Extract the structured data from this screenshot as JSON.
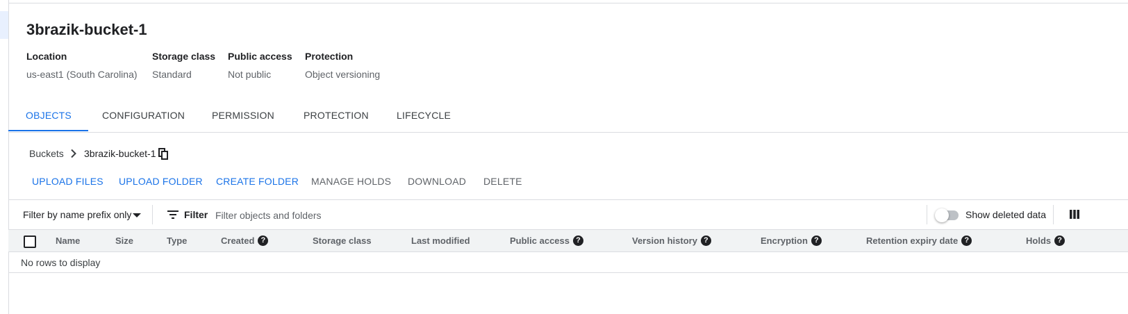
{
  "bucket": {
    "name": "3brazik-bucket-1",
    "details": [
      {
        "label": "Location",
        "value": "us-east1 (South Carolina)"
      },
      {
        "label": "Storage class",
        "value": "Standard"
      },
      {
        "label": "Public access",
        "value": "Not public"
      },
      {
        "label": "Protection",
        "value": "Object versioning"
      }
    ]
  },
  "tabs": [
    {
      "label": "OBJECTS",
      "active": true
    },
    {
      "label": "CONFIGURATION",
      "active": false
    },
    {
      "label": "PERMISSION",
      "active": false
    },
    {
      "label": "PROTECTION",
      "active": false
    },
    {
      "label": "LIFECYCLE",
      "active": false
    }
  ],
  "breadcrumb": {
    "root": "Buckets",
    "current": "3brazik-bucket-1"
  },
  "actions": [
    {
      "label": "UPLOAD FILES",
      "enabled": true
    },
    {
      "label": "UPLOAD FOLDER",
      "enabled": true
    },
    {
      "label": "CREATE FOLDER",
      "enabled": true
    },
    {
      "label": "MANAGE HOLDS",
      "enabled": false
    },
    {
      "label": "DOWNLOAD",
      "enabled": false
    },
    {
      "label": "DELETE",
      "enabled": false
    }
  ],
  "filter": {
    "prefix_select": "Filter by name prefix only",
    "label": "Filter",
    "placeholder": "Filter objects and folders",
    "show_deleted_label": "Show deleted data",
    "show_deleted": false
  },
  "table": {
    "columns": [
      {
        "label": "Name",
        "help": false
      },
      {
        "label": "Size",
        "help": false
      },
      {
        "label": "Type",
        "help": false
      },
      {
        "label": "Created",
        "help": true
      },
      {
        "label": "Storage class",
        "help": false
      },
      {
        "label": "Last modified",
        "help": false
      },
      {
        "label": "Public access",
        "help": true
      },
      {
        "label": "Version history",
        "help": true
      },
      {
        "label": "Encryption",
        "help": true
      },
      {
        "label": "Retention expiry date",
        "help": true
      },
      {
        "label": "Holds",
        "help": true
      }
    ],
    "empty_text": "No rows to display",
    "help_glyph": "?"
  },
  "colors": {
    "accent": "#1a73e8",
    "disabled": "#5f6368",
    "header_bg": "#f1f3f4"
  },
  "icons": [
    "chevron-right-icon",
    "copy-icon",
    "caret-down-icon",
    "filter-list-icon",
    "column-display-icon",
    "help-icon"
  ]
}
